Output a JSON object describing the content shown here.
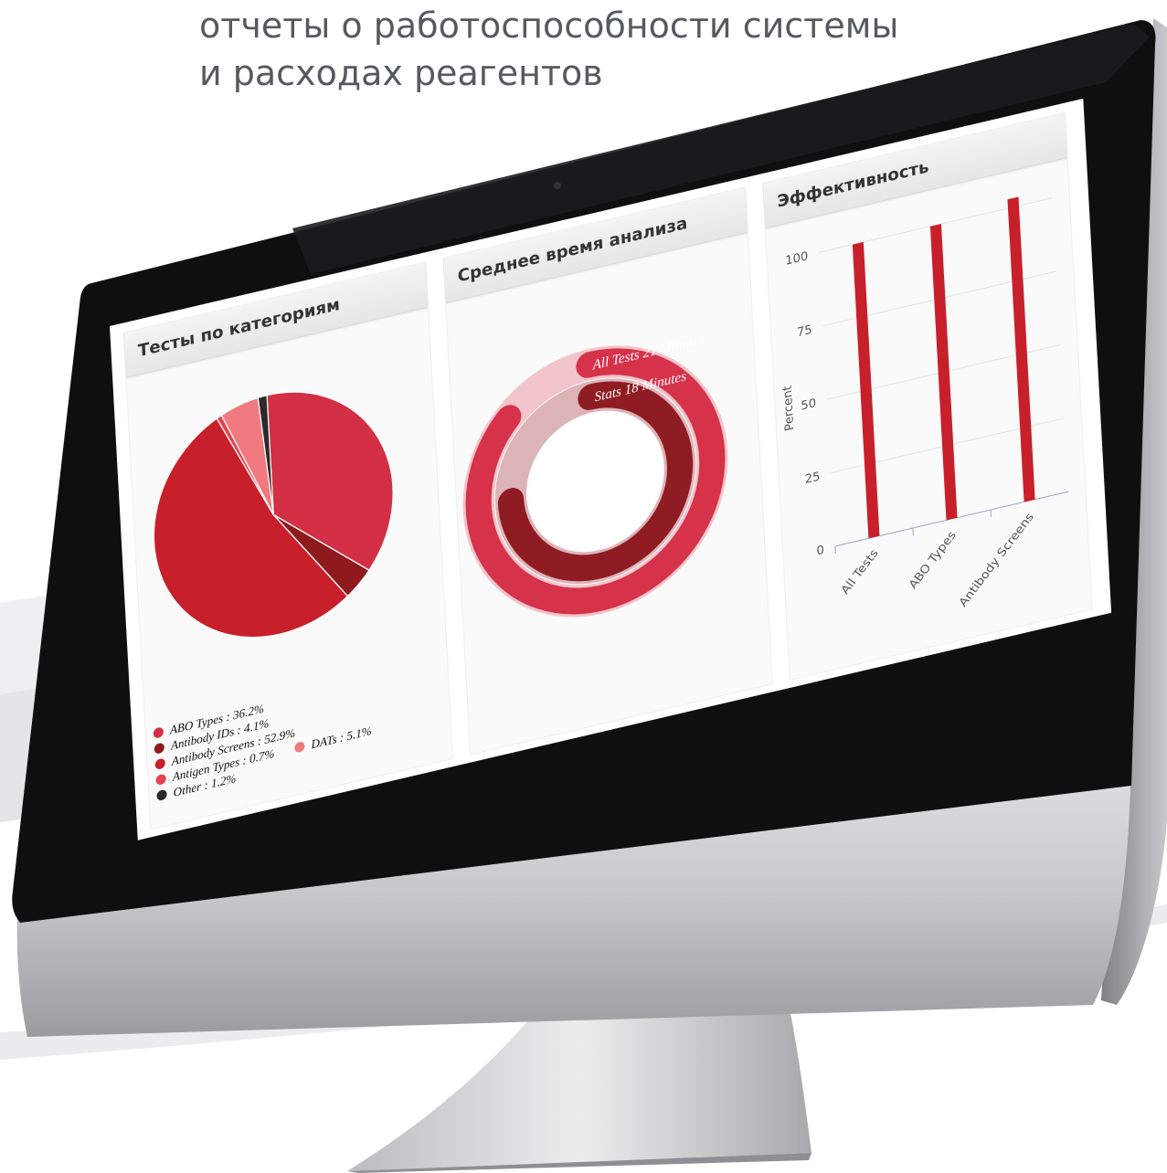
{
  "header": {
    "line1": "отчеты о работоспособности системы",
    "line2": "и расходах реагентов"
  },
  "colors": {
    "accent": "#c8202b",
    "bezel": "#0f0f10",
    "chin": "#c7c9cb"
  },
  "camera_icon": "camera-icon",
  "panels": {
    "categories": {
      "title": "Тесты по категориям"
    },
    "avg_time": {
      "title": "Среднее время анализа"
    },
    "efficiency": {
      "title": "Эффективность"
    }
  },
  "chart_data": [
    {
      "type": "pie",
      "title": "Тесты по категориям",
      "slices": [
        {
          "label": "ABO Types : 36.2%",
          "name": "ABO Types",
          "value": 36.2,
          "color": "#d32f45"
        },
        {
          "label": "Antibody IDs : 4.1%",
          "name": "Antibody IDs",
          "value": 4.1,
          "color": "#8e1a1e"
        },
        {
          "label": "Antibody Screens : 52.9%",
          "name": "Antibody Screens",
          "value": 52.9,
          "color": "#c8202b"
        },
        {
          "label": "Antigen Types : 0.7%",
          "name": "Antigen Types",
          "value": 0.7,
          "color": "#e8424c"
        },
        {
          "label": "DATs : 5.1%",
          "name": "DATs",
          "value": 5.1,
          "color": "#f07a80"
        },
        {
          "label": "Other : 1.2%",
          "name": "Other",
          "value": 1.2,
          "color": "#2a2a2a"
        }
      ],
      "legend": "bottom"
    },
    {
      "type": "radial-bar",
      "title": "Среднее время анализа",
      "max": 24,
      "bars": [
        {
          "label": "All Tests 21 Minutes",
          "value": 21,
          "color": "#d6324a",
          "track": "#f2c4cb"
        },
        {
          "label": "Stats 18 Minutes",
          "value": 18,
          "color": "#8f1c22",
          "track": "#dcb4b8"
        }
      ]
    },
    {
      "type": "bar",
      "title": "Эффективность",
      "categories": [
        "All Tests",
        "ABO Types",
        "Antibody Screens"
      ],
      "values": [
        100,
        100,
        103
      ],
      "ylabel": "Percent",
      "ylim": [
        0,
        100
      ],
      "yticks": [
        "0",
        "25",
        "50",
        "75",
        "100"
      ],
      "grid": true
    }
  ]
}
